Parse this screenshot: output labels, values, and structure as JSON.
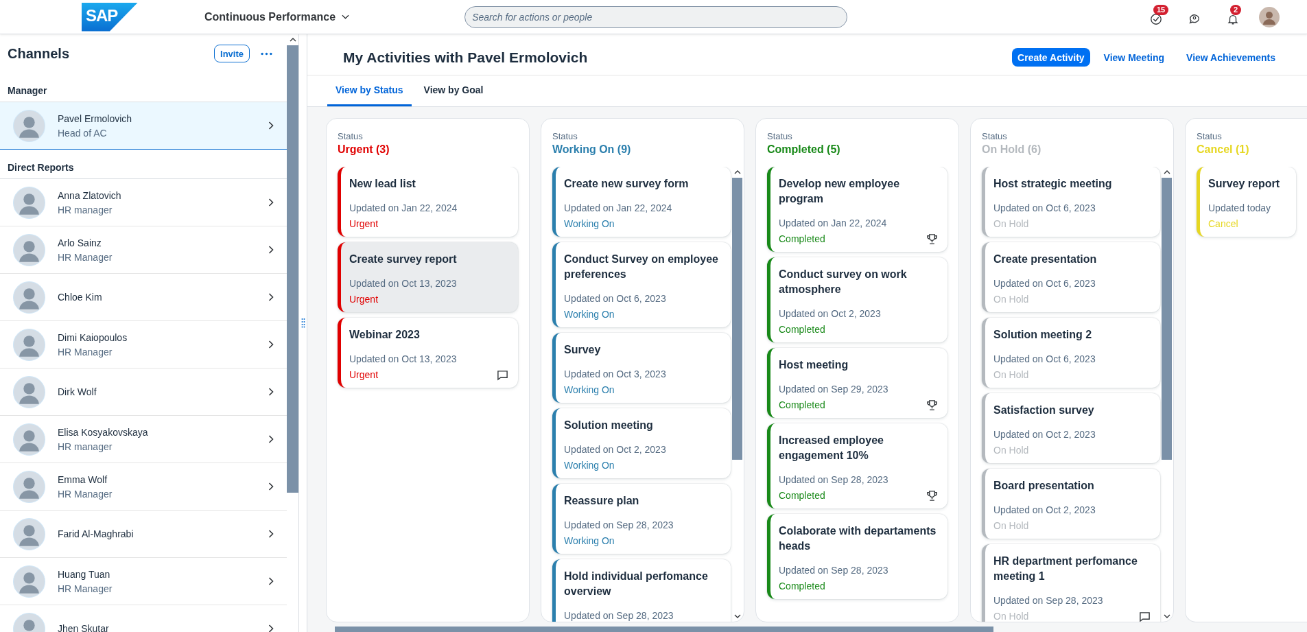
{
  "header": {
    "logo": "SAP",
    "app_title": "Continuous Performance",
    "search": {
      "placeholder": "Search for actions or people"
    },
    "tasks_badge": "15",
    "notifications_badge": "2"
  },
  "sidebar": {
    "title": "Channels",
    "invite_button": "Invite",
    "sections": [
      {
        "heading": "Manager",
        "items": [
          {
            "name": "Pavel Ermolovich",
            "role": "Head of AC",
            "selected": true
          }
        ]
      },
      {
        "heading": "Direct Reports",
        "items": [
          {
            "name": "Anna Zlatovich",
            "role": "HR manager",
            "selected": false
          },
          {
            "name": "Arlo Sainz",
            "role": "HR Manager",
            "selected": false
          },
          {
            "name": "Chloe Kim",
            "selected": false
          },
          {
            "name": "Dimi Kaiopoulos",
            "role": "HR Manager",
            "selected": false
          },
          {
            "name": "Dirk Wolf",
            "selected": false
          },
          {
            "name": "Elisa Kosyakovskaya",
            "role": "HR manager",
            "selected": false
          },
          {
            "name": "Emma Wolf",
            "role": "HR Manager",
            "selected": false
          },
          {
            "name": "Farid Al-Maghrabi",
            "selected": false
          },
          {
            "name": "Huang Tuan",
            "role": "HR Manager",
            "selected": false
          },
          {
            "name": "Jhen Skutar",
            "selected": false
          }
        ]
      }
    ]
  },
  "main": {
    "title": "My Activities with Pavel Ermolovich",
    "actions": [
      {
        "label": "Create Activity",
        "kind": "primary"
      },
      {
        "label": "View Meeting",
        "kind": "link"
      },
      {
        "label": "View Achievements",
        "kind": "link"
      }
    ],
    "tabs": [
      {
        "label": "View by Status",
        "selected": true
      },
      {
        "label": "View by Goal",
        "selected": false
      }
    ],
    "columns": [
      {
        "label": "Status",
        "title": "Urgent (3)",
        "color": "#e00000",
        "scrollbar": false,
        "cards": [
          {
            "title": "New lead list",
            "updated": "Updated on Jan 22, 2024",
            "status": "Urgent",
            "selected": false
          },
          {
            "title": "Create survey report",
            "updated": "Updated on Oct 13, 2023",
            "status": "Urgent",
            "selected": true
          },
          {
            "title": "Webinar 2023",
            "updated": "Updated on Oct 13, 2023",
            "status": "Urgent",
            "kind": "comment",
            "selected": false
          }
        ]
      },
      {
        "label": "Status",
        "title": "Working On (9)",
        "color": "#2b7fad",
        "scrollbar": true,
        "cards": [
          {
            "title": "Create new survey form",
            "updated": "Updated on Jan 22, 2024",
            "status": "Working On",
            "selected": false
          },
          {
            "title": "Conduct Survey on employee preferences",
            "updated": "Updated on Oct 6, 2023",
            "status": "Working On",
            "selected": false
          },
          {
            "title": "Survey",
            "updated": "Updated on Oct 3, 2023",
            "status": "Working On",
            "selected": false
          },
          {
            "title": "Solution meeting",
            "updated": "Updated on Oct 2, 2023",
            "status": "Working On",
            "selected": false
          },
          {
            "title": "Reassure plan",
            "updated": "Updated on Sep 28, 2023",
            "status": "Working On",
            "selected": false
          },
          {
            "title": "Hold individual perfomance overview",
            "updated": "Updated on Sep 28, 2023",
            "selected": false
          }
        ]
      },
      {
        "label": "Status",
        "title": "Completed (5)",
        "color": "#188918",
        "scrollbar": false,
        "cards": [
          {
            "title": "Develop new employee program",
            "updated": "Updated on Jan 22, 2024",
            "status": "Completed",
            "kind": "trophy",
            "selected": false
          },
          {
            "title": "Conduct survey on work atmosphere",
            "updated": "Updated on Oct 2, 2023",
            "status": "Completed",
            "selected": false
          },
          {
            "title": "Host meeting",
            "updated": "Updated on Sep 29, 2023",
            "status": "Completed",
            "kind": "trophy",
            "selected": false
          },
          {
            "title": "Increased employee engagement 10%",
            "updated": "Updated on Sep 28, 2023",
            "status": "Completed",
            "kind": "trophy",
            "selected": false
          },
          {
            "title": "Colaborate with departaments heads",
            "updated": "Updated on Sep 28, 2023",
            "status": "Completed",
            "selected": false
          }
        ]
      },
      {
        "label": "Status",
        "title": "On Hold (6)",
        "color": "#b4b9be",
        "scrollbar": true,
        "cards": [
          {
            "title": "Host strategic meeting",
            "updated": "Updated on Oct 6, 2023",
            "status": "On Hold",
            "selected": false
          },
          {
            "title": "Create presentation",
            "updated": "Updated on Oct 6, 2023",
            "status": "On Hold",
            "selected": false
          },
          {
            "title": "Solution meeting 2",
            "updated": "Updated on Oct 6, 2023",
            "status": "On Hold",
            "selected": false
          },
          {
            "title": "Satisfaction survey",
            "updated": "Updated on Oct 2, 2023",
            "status": "On Hold",
            "selected": false
          },
          {
            "title": "Board presentation",
            "updated": "Updated on Oct 2, 2023",
            "status": "On Hold",
            "selected": false
          },
          {
            "title": "HR department perfomance meeting 1",
            "updated": "Updated on Sep 28, 2023",
            "status": "On Hold",
            "kind": "comment",
            "selected": false
          }
        ]
      },
      {
        "label": "Status",
        "title": "Cancel (1)",
        "color": "#e6d722",
        "scrollbar": false,
        "cards": [
          {
            "title": "Survey report",
            "updated": "Updated today",
            "status": "Cancel",
            "selected": false
          }
        ]
      }
    ]
  }
}
